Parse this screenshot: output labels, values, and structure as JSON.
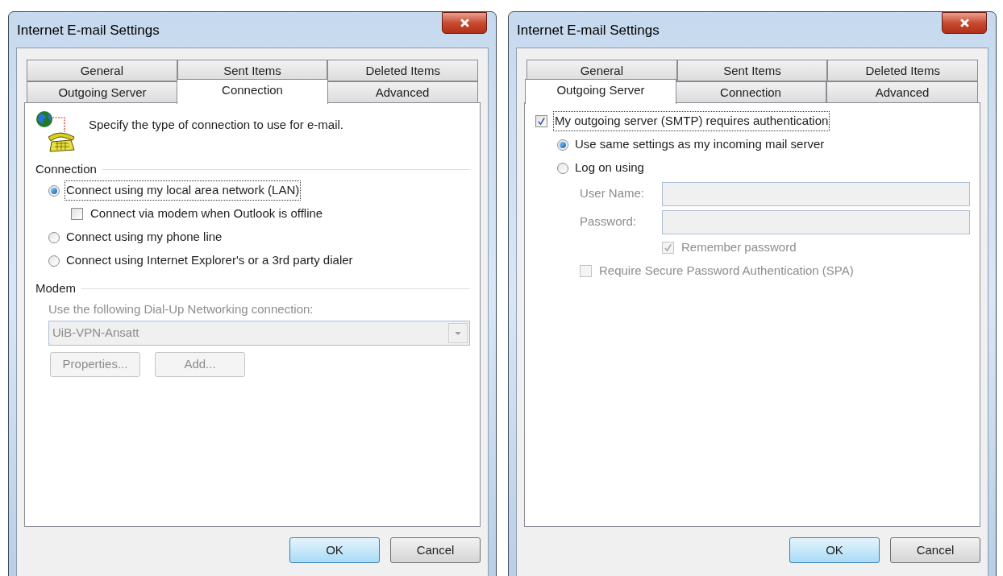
{
  "dialogs": [
    {
      "title": "Internet E-mail Settings",
      "tab_rows": [
        [
          {
            "label": "General",
            "selected": false
          },
          {
            "label": "Sent Items",
            "selected": false
          },
          {
            "label": "Deleted Items",
            "selected": false
          }
        ],
        [
          {
            "label": "Outgoing Server",
            "selected": false
          },
          {
            "label": "Connection",
            "selected": true
          },
          {
            "label": "Advanced",
            "selected": false
          }
        ]
      ],
      "content": [
        {
          "kind": "intro",
          "text": "Specify the type of connection to use for e-mail."
        },
        {
          "kind": "group",
          "label": "Connection",
          "children": [
            {
              "kind": "radio",
              "label": "Connect using my local area network (LAN)",
              "selected": true,
              "focused": true,
              "disabled": false,
              "children": [
                {
                  "kind": "checkbox",
                  "label": "Connect via modem when Outlook is offline",
                  "checked": false,
                  "disabled": false
                }
              ]
            },
            {
              "kind": "radio",
              "label": "Connect using my phone line",
              "selected": false,
              "focused": false,
              "disabled": false
            },
            {
              "kind": "radio",
              "label": "Connect using Internet Explorer's or a 3rd party dialer",
              "selected": false,
              "focused": false,
              "disabled": false
            }
          ]
        },
        {
          "kind": "group",
          "label": "Modem",
          "children": [
            {
              "kind": "label",
              "text": "Use the following Dial-Up Networking connection:",
              "disabled": true
            },
            {
              "kind": "dropdown",
              "value": "UiB-VPN-Ansatt",
              "disabled": true
            },
            {
              "kind": "buttons",
              "buttons": [
                {
                  "label": "Properties...",
                  "disabled": true
                },
                {
                  "label": "Add...",
                  "disabled": true
                }
              ]
            }
          ]
        }
      ],
      "buttons": [
        {
          "label": "OK",
          "default": true
        },
        {
          "label": "Cancel",
          "default": false
        }
      ]
    },
    {
      "title": "Internet E-mail Settings",
      "tab_rows": [
        [
          {
            "label": "General",
            "selected": false
          },
          {
            "label": "Sent Items",
            "selected": false
          },
          {
            "label": "Deleted Items",
            "selected": false
          }
        ],
        [
          {
            "label": "Outgoing Server",
            "selected": true
          },
          {
            "label": "Connection",
            "selected": false
          },
          {
            "label": "Advanced",
            "selected": false
          }
        ]
      ],
      "content": [
        {
          "kind": "checkbox",
          "label": "My outgoing server (SMTP) requires authentication",
          "checked": true,
          "focused": true,
          "disabled": false,
          "children": [
            {
              "kind": "radio",
              "label": "Use same settings as my incoming mail server",
              "selected": true,
              "focused": false,
              "disabled": false
            },
            {
              "kind": "radio",
              "label": "Log on using",
              "selected": false,
              "focused": false,
              "disabled": false,
              "children": [
                {
                  "kind": "field",
                  "label": "User Name:",
                  "disabled": true
                },
                {
                  "kind": "field",
                  "label": "Password:",
                  "disabled": true,
                  "children": [
                    {
                      "kind": "checkbox",
                      "label": "Remember password",
                      "checked": true,
                      "disabled": true
                    }
                  ]
                },
                {
                  "kind": "checkbox",
                  "label": "Require Secure Password Authentication (SPA)",
                  "checked": false,
                  "disabled": true
                }
              ]
            }
          ]
        }
      ],
      "buttons": [
        {
          "label": "OK",
          "default": true
        },
        {
          "label": "Cancel",
          "default": false
        }
      ]
    }
  ]
}
